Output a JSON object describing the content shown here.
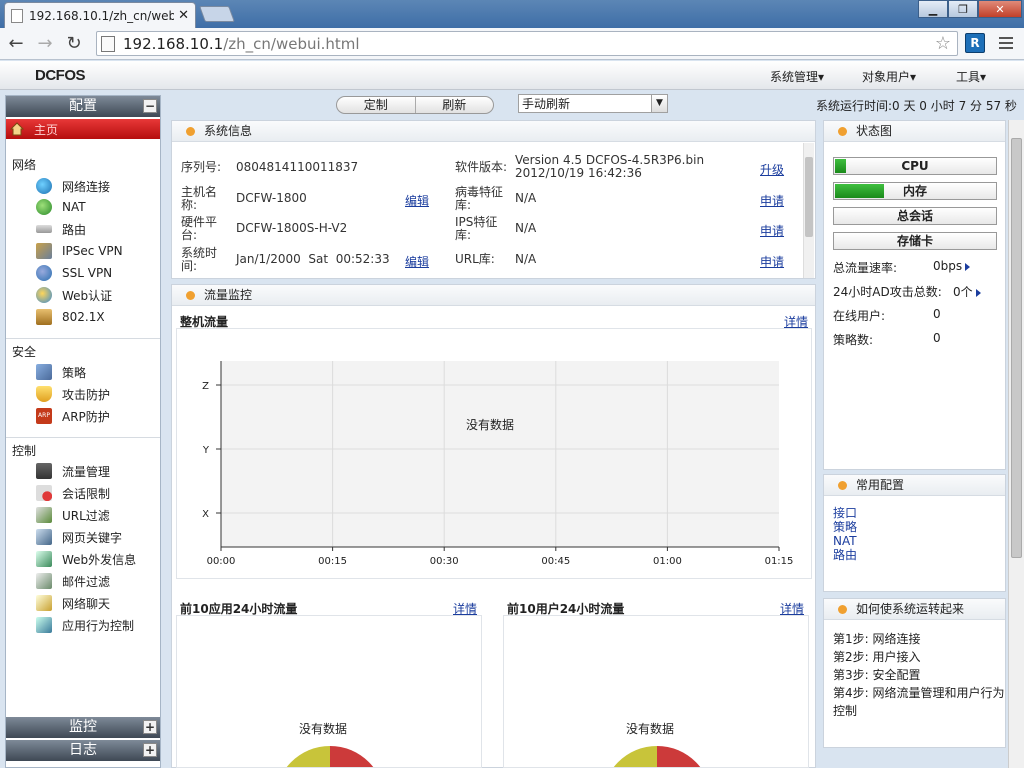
{
  "browser": {
    "tab_title": "192.168.10.1/zh_cn/web",
    "url_host": "192.168.10.1",
    "url_path": "/zh_cn/webui.html"
  },
  "app": {
    "logo": "DCFOS",
    "menu": [
      "系统管理▾",
      "对象用户▾",
      "工具▾"
    ]
  },
  "sidebar": {
    "config_label": "配置",
    "home": "主页",
    "groups": [
      {
        "name": "网络",
        "items": [
          "网络连接",
          "NAT",
          "路由",
          "IPSec VPN",
          "SSL VPN",
          "Web认证",
          "802.1X"
        ]
      },
      {
        "name": "安全",
        "items": [
          "策略",
          "攻击防护",
          "ARP防护"
        ]
      },
      {
        "name": "控制",
        "items": [
          "流量管理",
          "会话限制",
          "URL过滤",
          "网页关键字",
          "Web外发信息",
          "邮件过滤",
          "网络聊天",
          "应用行为控制"
        ]
      }
    ],
    "monitor_label": "监控",
    "log_label": "日志"
  },
  "topbar": {
    "customize": "定制",
    "refresh": "刷新",
    "refresh_mode": "手动刷新",
    "uptime": "系统运行时间:0 天 0 小时 7 分 57 秒"
  },
  "sysinfo": {
    "title": "系统信息",
    "serial_label": "序列号:",
    "serial": "0804814110011837",
    "host_label": "主机名称:",
    "host": "DCFW-1800",
    "hw_label": "硬件平台:",
    "hw": "DCFW-1800S-H-V2",
    "time_label": "系统时间:",
    "time": "Jan/1/2000  Sat  00:52:33",
    "edit": "编辑",
    "sw_label": "软件版本:",
    "sw": "Version 4.5 DCFOS-4.5R3P6.bin 2012/10/19 16:42:36",
    "av_label": "病毒特征库:",
    "av": "N/A",
    "ips_label": "IPS特征库:",
    "ips": "N/A",
    "url_label": "URL库:",
    "url": "N/A",
    "upgrade": "升级",
    "apply": "申请"
  },
  "traffic": {
    "title": "流量监控",
    "whole_title": "整机流量",
    "detail": "详情",
    "no_data": "没有数据",
    "top_apps": "前10应用24小时流量",
    "top_users": "前10用户24小时流量"
  },
  "chart_data": {
    "type": "line",
    "x_ticks": [
      "00:00",
      "00:15",
      "00:30",
      "00:45",
      "01:00",
      "01:15"
    ],
    "y_ticks": [
      "X",
      "Y",
      "Z"
    ],
    "series": [],
    "annotation": "没有数据",
    "grid": true
  },
  "status": {
    "title": "状态图",
    "cpu": "CPU",
    "cpu_usage": 0.07,
    "mem": "内存",
    "mem_usage": 0.3,
    "sessions": "总会话",
    "storage": "存储卡",
    "rate_label": "总流量速率:",
    "rate": "0bps",
    "ad_label": "24小时AD攻击总数:",
    "ad": "0个",
    "online_label": "在线用户:",
    "online": "0",
    "policy_label": "策略数:",
    "policy": "0"
  },
  "common": {
    "title": "常用配置",
    "links": [
      "接口",
      "策略",
      "NAT",
      "路由"
    ]
  },
  "howto": {
    "title": "如何使系统运转起来",
    "steps": [
      "第1步: 网络连接",
      "第2步: 用户接入",
      "第3步: 安全配置",
      "第4步: 网络流量管理和用户行为控制"
    ]
  },
  "colors": {
    "accent_orange": "#f0a030",
    "home_red": "#d41c1c",
    "pie_red": "#cc3a3a",
    "pie_yellow": "#c8c43a"
  }
}
